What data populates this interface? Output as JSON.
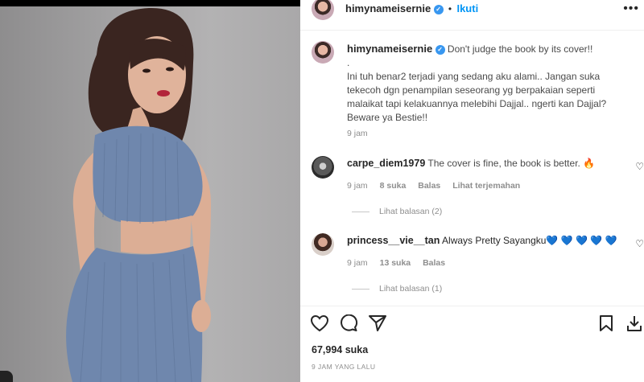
{
  "post": {
    "username": "himynameisernie",
    "follow_label": "Ikuti",
    "separator": "•",
    "verified_mark": "✓",
    "more_icon": "more-horizontal-icon",
    "likes": "67,994 suka",
    "time_ago": "9 JAM YANG LALU"
  },
  "caption": {
    "username": "himynameisernie",
    "first_line": "Don't judge the book by its cover!!",
    "dot_line": ".",
    "body": "Ini tuh benar2 terjadi yang sedang aku alami.. Jangan suka tekecoh dgn penampilan seseorang yg berpakaian seperti malaikat tapi kelakuannya melebihi Dajjal.. ngerti kan Dajjal? Beware ya Bestie!!",
    "time": "9 jam"
  },
  "comments": [
    {
      "username": "carpe_diem1979",
      "text": "The cover is fine, the book is better. 🔥",
      "time": "9 jam",
      "likes": "8 suka",
      "reply_label": "Balas",
      "translate_label": "Lihat terjemahan",
      "view_replies": "Lihat balasan (2)"
    },
    {
      "username": "princess__vie__tan",
      "text": "Always Pretty Sayangku💙 💙 💙 💙 💙",
      "time": "9 jam",
      "likes": "13 suka",
      "reply_label": "Balas",
      "view_replies": "Lihat balasan (1)"
    }
  ],
  "icons": {
    "like": "heart-icon",
    "comment": "comment-icon",
    "share": "send-icon",
    "save": "bookmark-icon",
    "download": "download-icon"
  },
  "colors": {
    "accent": "#0095f6",
    "verified": "#3897f0",
    "dress": "#6f87ad",
    "text": "#262626",
    "muted": "#8e8e8e"
  }
}
